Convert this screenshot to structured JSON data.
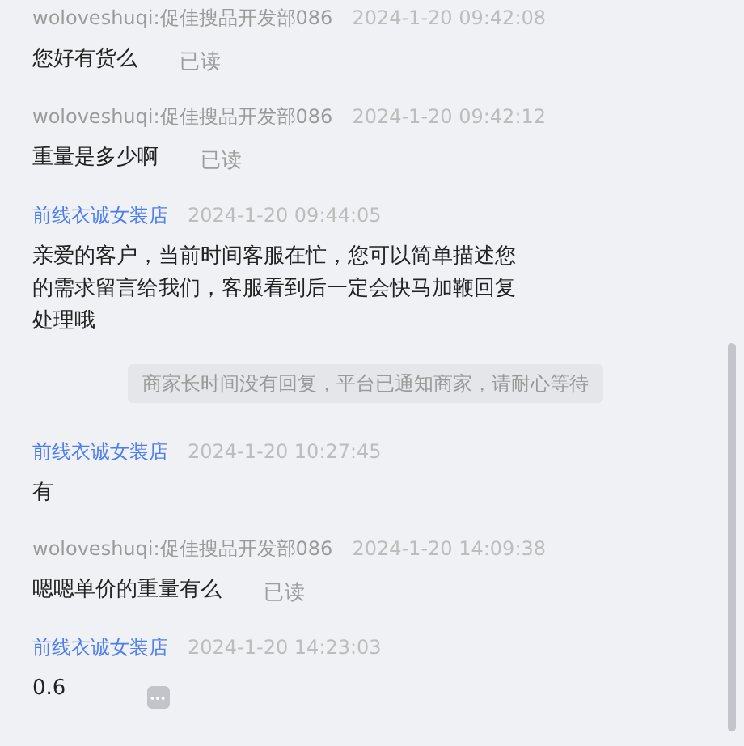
{
  "messages": [
    {
      "kind": "message",
      "color": "#9a9a9a",
      "sender": "woloveshuqi:促佳搜品开发部086",
      "time": "2024-1-20 09:42:08",
      "text": "您好有货么",
      "status": "已读"
    },
    {
      "kind": "message",
      "color": "#9a9a9a",
      "sender": "woloveshuqi:促佳搜品开发部086",
      "time": "2024-1-20 09:42:12",
      "text": "重量是多少啊",
      "status": "已读"
    },
    {
      "kind": "message",
      "color": "#4d7ef0",
      "sender": "前线衣诚女装店",
      "time": "2024-1-20 09:44:05",
      "text": "亲爱的客户，当前时间客服在忙，您可以简单描述您的需求留言给我们，客服看到后一定会快马加鞭回复处理哦"
    },
    {
      "kind": "notice",
      "text": "商家长时间没有回复，平台已通知商家，请耐心等待"
    },
    {
      "kind": "message",
      "color": "#4d7ef0",
      "sender": "前线衣诚女装店",
      "time": "2024-1-20 10:27:45",
      "text": "有"
    },
    {
      "kind": "message",
      "color": "#9a9a9a",
      "sender": "woloveshuqi:促佳搜品开发部086",
      "time": "2024-1-20 14:09:38",
      "text": "嗯嗯单价的重量有么",
      "status": "已读"
    },
    {
      "kind": "message",
      "color": "#4d7ef0",
      "sender": "前线衣诚女装店",
      "time": "2024-1-20 14:23:03",
      "text": "0.6",
      "more_button": true
    }
  ]
}
